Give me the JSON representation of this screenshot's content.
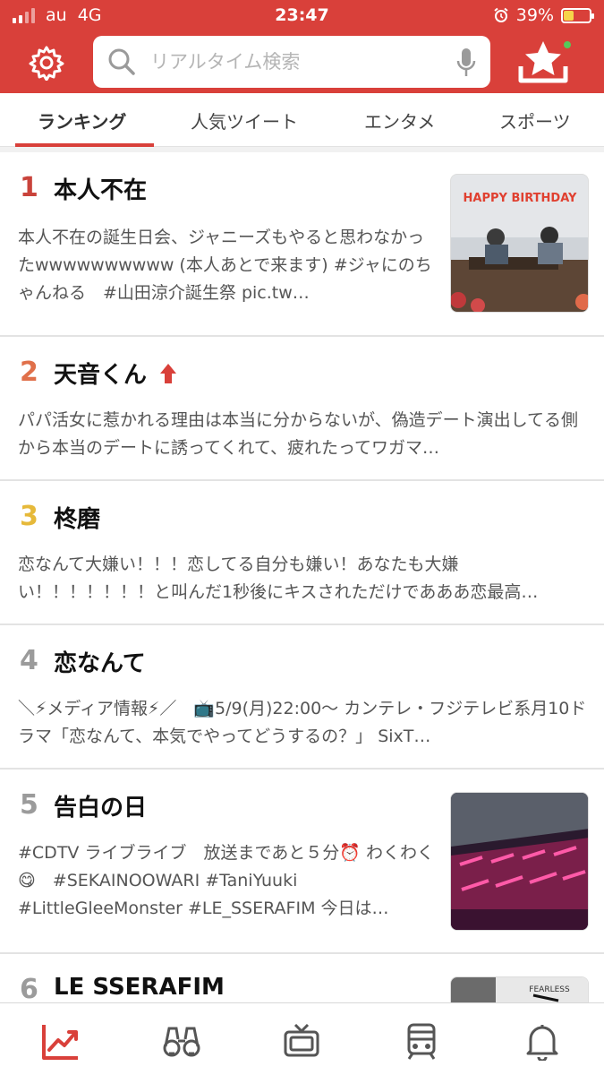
{
  "status_bar": {
    "carrier": "au",
    "network": "4G",
    "time": "23:47",
    "battery": "39%"
  },
  "search": {
    "placeholder": "リアルタイム検索"
  },
  "tabs": [
    {
      "label": "ランキング",
      "active": true
    },
    {
      "label": "人気ツイート",
      "active": false
    },
    {
      "label": "エンタメ",
      "active": false
    },
    {
      "label": "スポーツ",
      "active": false
    }
  ],
  "ranking": [
    {
      "rank": "1",
      "title": "本人不在",
      "desc": "本人不在の誕生日会、ジャニーズもやると思わなかったwwwwwwwwww (本人あとで来ます) #ジャにのちゃんねる　#山田涼介誕生祭 pic.tw…",
      "thumb_text": "HAPPY BIRTHDAY"
    },
    {
      "rank": "2",
      "title": "天音くん",
      "desc": "パパ活女に惹かれる理由は本当に分からないが、偽造デート演出してる側から本当のデートに誘ってくれて、疲れたってワガマ…"
    },
    {
      "rank": "3",
      "title": "柊磨",
      "desc": "恋なんて大嫌い！！！恋してる自分も嫌い！あなたも大嫌い！！！！！！！と叫んだ1秒後にキスされただけであああ恋最高…"
    },
    {
      "rank": "4",
      "title": "恋なんて",
      "desc": "＼⚡メディア情報⚡／　📺5/9(月)22:00～ カンテレ・フジテレビ系月10ドラマ「恋なんて、本気でやってどうするの？」 SixT…"
    },
    {
      "rank": "5",
      "title": "告白の日",
      "desc": "#CDTV ライブライブ　放送まであと５分⏰ わくわく😋　#SEKAINOOWARI #TaniYuuki #LittleGleeMonster #LE_SSERAFIM 今日は…"
    },
    {
      "rank": "6",
      "title": "LE SSERAFIM",
      "thumb_text": "FEARLESS"
    }
  ],
  "colors": {
    "brand_red": "#d9403a",
    "rank1": "#c9433b",
    "rank2": "#e0704a",
    "rank3": "#e6b93a",
    "rank_other": "#9b9b9b"
  },
  "icons": {
    "settings": "gear-icon",
    "search": "search-icon",
    "voice": "microphone-icon",
    "trend_notice": "star-tray-icon",
    "nav": [
      "trending-icon",
      "binoculars-icon",
      "tv-icon",
      "train-icon",
      "bell-icon"
    ]
  }
}
